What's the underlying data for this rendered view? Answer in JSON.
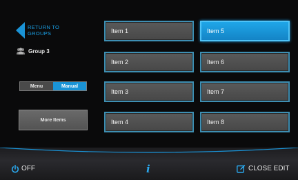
{
  "nav": {
    "back_label": "RETURN TO GROUPS"
  },
  "group": {
    "label": "Group 3",
    "icon": "people-icon"
  },
  "mode_toggle": {
    "options": [
      "Menu",
      "Manual"
    ],
    "selected": "Manual"
  },
  "more_items_label": "More Items",
  "items": {
    "item1": "Item 1",
    "item2": "Item 2",
    "item3": "Item 3",
    "item4": "Item 4",
    "item5": "Item 5",
    "item6": "Item 6",
    "item7": "Item 7",
    "item8": "Item 8"
  },
  "selected_item": "Item 5",
  "bottom_bar": {
    "off_label": "OFF",
    "info_glyph": "i",
    "close_edit_label": "CLOSE EDIT"
  },
  "colors": {
    "accent": "#1a93d6",
    "item_border": "#3e8fb3",
    "item_bg": "#4f4f4f",
    "background": "#0a0a0b"
  }
}
